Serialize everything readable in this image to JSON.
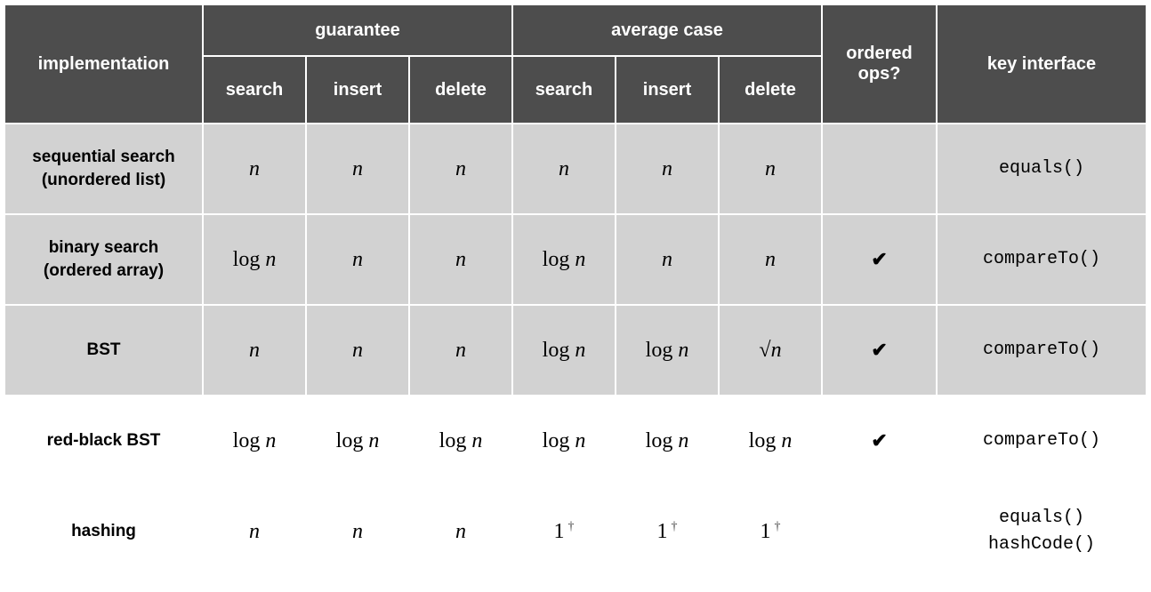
{
  "chart_data": {
    "type": "table",
    "title": "",
    "columns_top": [
      "implementation",
      "guarantee",
      "average case",
      "ordered ops?",
      "key interface"
    ],
    "columns_sub": [
      "search",
      "insert",
      "delete",
      "search",
      "insert",
      "delete"
    ],
    "rows": [
      {
        "impl": "sequential search (unordered list)",
        "guarantee": {
          "search": "n",
          "insert": "n",
          "delete": "n"
        },
        "average": {
          "search": "n",
          "insert": "n",
          "delete": "n"
        },
        "ordered_ops": false,
        "key_interface": [
          "equals()"
        ]
      },
      {
        "impl": "binary search (ordered array)",
        "guarantee": {
          "search": "log n",
          "insert": "n",
          "delete": "n"
        },
        "average": {
          "search": "log n",
          "insert": "n",
          "delete": "n"
        },
        "ordered_ops": true,
        "key_interface": [
          "compareTo()"
        ]
      },
      {
        "impl": "BST",
        "guarantee": {
          "search": "n",
          "insert": "n",
          "delete": "n"
        },
        "average": {
          "search": "log n",
          "insert": "log n",
          "delete": "√n"
        },
        "ordered_ops": true,
        "key_interface": [
          "compareTo()"
        ]
      },
      {
        "impl": "red-black BST",
        "guarantee": {
          "search": "log n",
          "insert": "log n",
          "delete": "log n"
        },
        "average": {
          "search": "log n",
          "insert": "log n",
          "delete": "log n"
        },
        "ordered_ops": true,
        "key_interface": [
          "compareTo()"
        ]
      },
      {
        "impl": "hashing",
        "guarantee": {
          "search": "n",
          "insert": "n",
          "delete": "n"
        },
        "average": {
          "search": "1 †",
          "insert": "1 †",
          "delete": "1 †"
        },
        "ordered_ops": false,
        "key_interface": [
          "equals()",
          "hashCode()"
        ]
      }
    ]
  },
  "headers": {
    "impl": "implementation",
    "guarantee": "guarantee",
    "average": "average case",
    "ordered": "ordered ops?",
    "keyif": "key interface",
    "search": "search",
    "insert": "insert",
    "delete": "delete"
  },
  "rows": {
    "0": {
      "implA": "sequential search",
      "implB": "(unordered list)",
      "ord": "",
      "k0": "equals()",
      "k1": ""
    },
    "1": {
      "implA": "binary search",
      "implB": "(ordered array)",
      "ord": "✔",
      "k0": "compareTo()",
      "k1": ""
    },
    "2": {
      "implA": "BST",
      "implB": "",
      "ord": "✔",
      "k0": "compareTo()",
      "k1": ""
    },
    "3": {
      "implA": "red-black BST",
      "implB": "",
      "ord": "✔",
      "k0": "compareTo()",
      "k1": ""
    },
    "4": {
      "implA": "hashing",
      "implB": "",
      "ord": "",
      "k0": "equals()",
      "k1": "hashCode()"
    }
  },
  "cells": {
    "0": {
      "gs": "n",
      "gi": "n",
      "gd": "n",
      "as": "n",
      "ai": "n",
      "ad": "n"
    },
    "1": {
      "gs": "log n",
      "gi": "n",
      "gd": "n",
      "as": "log n",
      "ai": "n",
      "ad": "n"
    },
    "2": {
      "gs": "n",
      "gi": "n",
      "gd": "n",
      "as": "log n",
      "ai": "log n",
      "ad": "√n"
    },
    "3": {
      "gs": "log n",
      "gi": "log n",
      "gd": "log n",
      "as": "log n",
      "ai": "log n",
      "ad": "log n"
    },
    "4": {
      "gs": "n",
      "gi": "n",
      "gd": "n",
      "as": "1 †",
      "ai": "1 †",
      "ad": "1 †"
    }
  }
}
